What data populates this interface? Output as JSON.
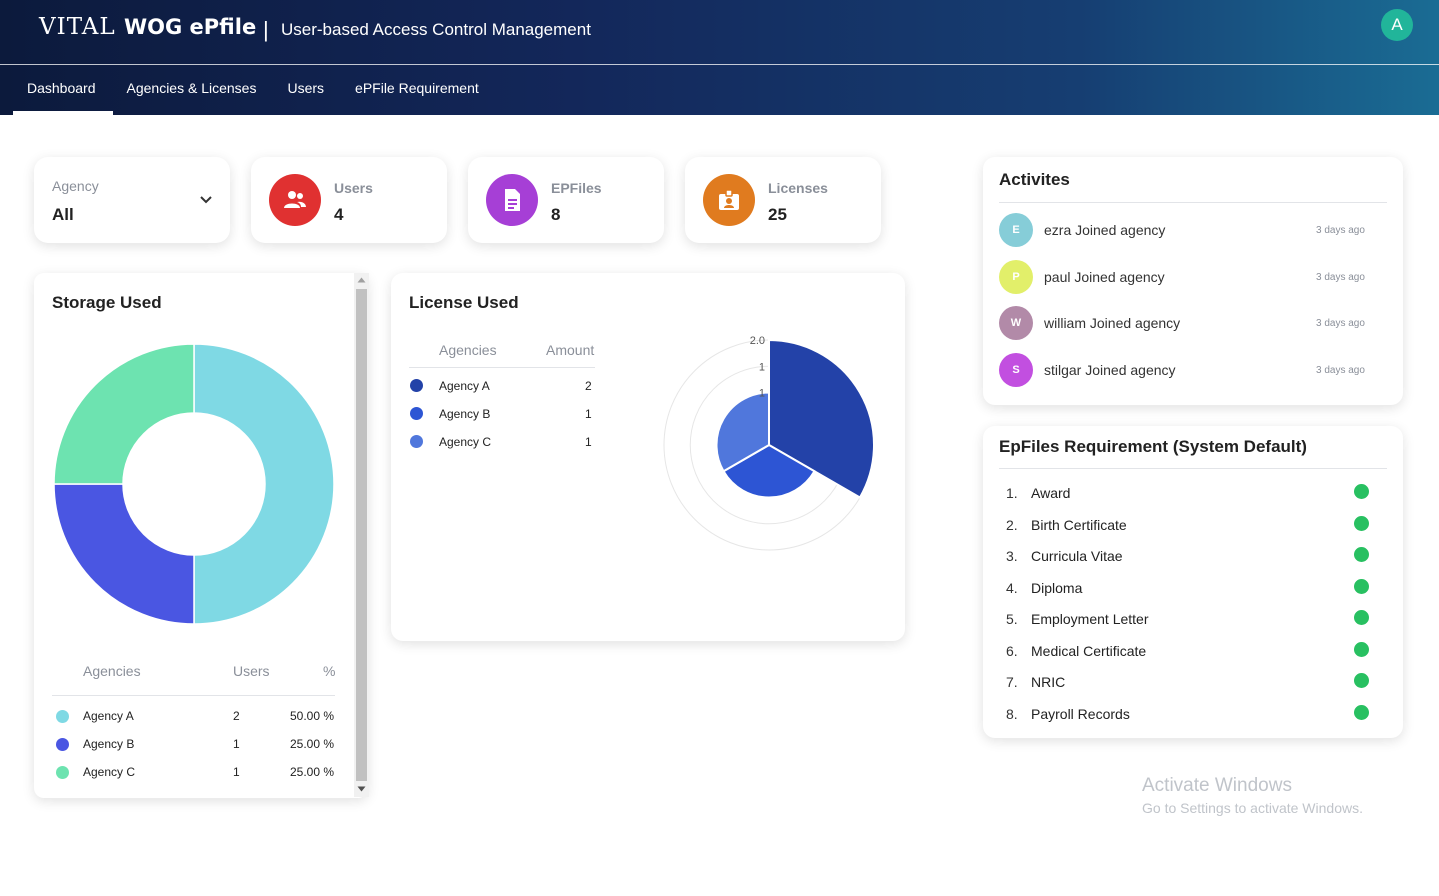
{
  "header": {
    "logo_part1": "VITAL",
    "logo_part2": "WOG ePfile",
    "separator": "|",
    "title": "User-based Access Control Management",
    "avatar_letter": "A",
    "avatar_color": "#21b59a"
  },
  "nav": {
    "tabs": [
      {
        "label": "Dashboard",
        "active": true
      },
      {
        "label": "Agencies & Licenses"
      },
      {
        "label": "Users"
      },
      {
        "label": "ePFile Requirement"
      }
    ]
  },
  "filter": {
    "label": "Agency",
    "value": "All",
    "icon": "chevron-down-icon"
  },
  "stats": [
    {
      "label": "Users",
      "value": "4",
      "color": "#e03131",
      "icon": "users-icon"
    },
    {
      "label": "EPFiles",
      "value": "8",
      "color": "#a63fd6",
      "icon": "document-icon"
    },
    {
      "label": "Licenses",
      "value": "25",
      "color": "#e07b1f",
      "icon": "id-badge-icon"
    }
  ],
  "storage": {
    "title": "Storage Used",
    "headers": {
      "agencies": "Agencies",
      "users": "Users",
      "percent": "%"
    },
    "rows": [
      {
        "name": "Agency A",
        "users": "2",
        "percent": "50.00 %",
        "color": "#7fd9e4"
      },
      {
        "name": "Agency B",
        "users": "1",
        "percent": "25.00 %",
        "color": "#4a56e2"
      },
      {
        "name": "Agency C",
        "users": "1",
        "percent": "25.00 %",
        "color": "#6de3b0"
      }
    ]
  },
  "license": {
    "title": "License Used",
    "headers": {
      "agencies": "Agencies",
      "amount": "Amount"
    },
    "rows": [
      {
        "name": "Agency A",
        "amount": "2",
        "color": "#2342a8"
      },
      {
        "name": "Agency B",
        "amount": "1",
        "color": "#2d55d4"
      },
      {
        "name": "Agency C",
        "amount": "1",
        "color": "#5077dc"
      }
    ]
  },
  "chart_data": [
    {
      "type": "pie",
      "variant": "donut",
      "categories": [
        "Agency A",
        "Agency B",
        "Agency C"
      ],
      "values": [
        2,
        1,
        1
      ],
      "colors": [
        "#7fd9e4",
        "#4a56e2",
        "#6de3b0"
      ]
    },
    {
      "type": "pie",
      "variant": "polar-area",
      "categories": [
        "Agency A",
        "Agency B",
        "Agency C"
      ],
      "values": [
        2,
        1,
        1
      ],
      "colors": [
        "#2342a8",
        "#2d55d4",
        "#5077dc"
      ],
      "radial_ticks": [
        "2.0",
        "1",
        "1"
      ]
    }
  ],
  "activities": {
    "title": "Activites",
    "items": [
      {
        "initial": "E",
        "text": "ezra Joined agency",
        "time": "3 days ago",
        "color": "#86cdd8"
      },
      {
        "initial": "P",
        "text": "paul Joined agency",
        "time": "3 days ago",
        "color": "#e2ef6a"
      },
      {
        "initial": "W",
        "text": "william Joined agency",
        "time": "3 days ago",
        "color": "#b28aa8"
      },
      {
        "initial": "S",
        "text": "stilgar Joined agency",
        "time": "3 days ago",
        "color": "#c24fe0"
      }
    ]
  },
  "requirements": {
    "title": "EpFiles Requirement (System Default)",
    "status_color": "#28c061",
    "items": [
      {
        "num": "1.",
        "label": "Award"
      },
      {
        "num": "2.",
        "label": "Birth Certificate"
      },
      {
        "num": "3.",
        "label": "Curricula Vitae"
      },
      {
        "num": "4.",
        "label": "Diploma"
      },
      {
        "num": "5.",
        "label": "Employment Letter"
      },
      {
        "num": "6.",
        "label": "Medical Certificate"
      },
      {
        "num": "7.",
        "label": "NRIC"
      },
      {
        "num": "8.",
        "label": "Payroll Records"
      }
    ]
  },
  "watermark": {
    "line1": "Activate Windows",
    "line2": "Go to Settings to activate Windows."
  }
}
